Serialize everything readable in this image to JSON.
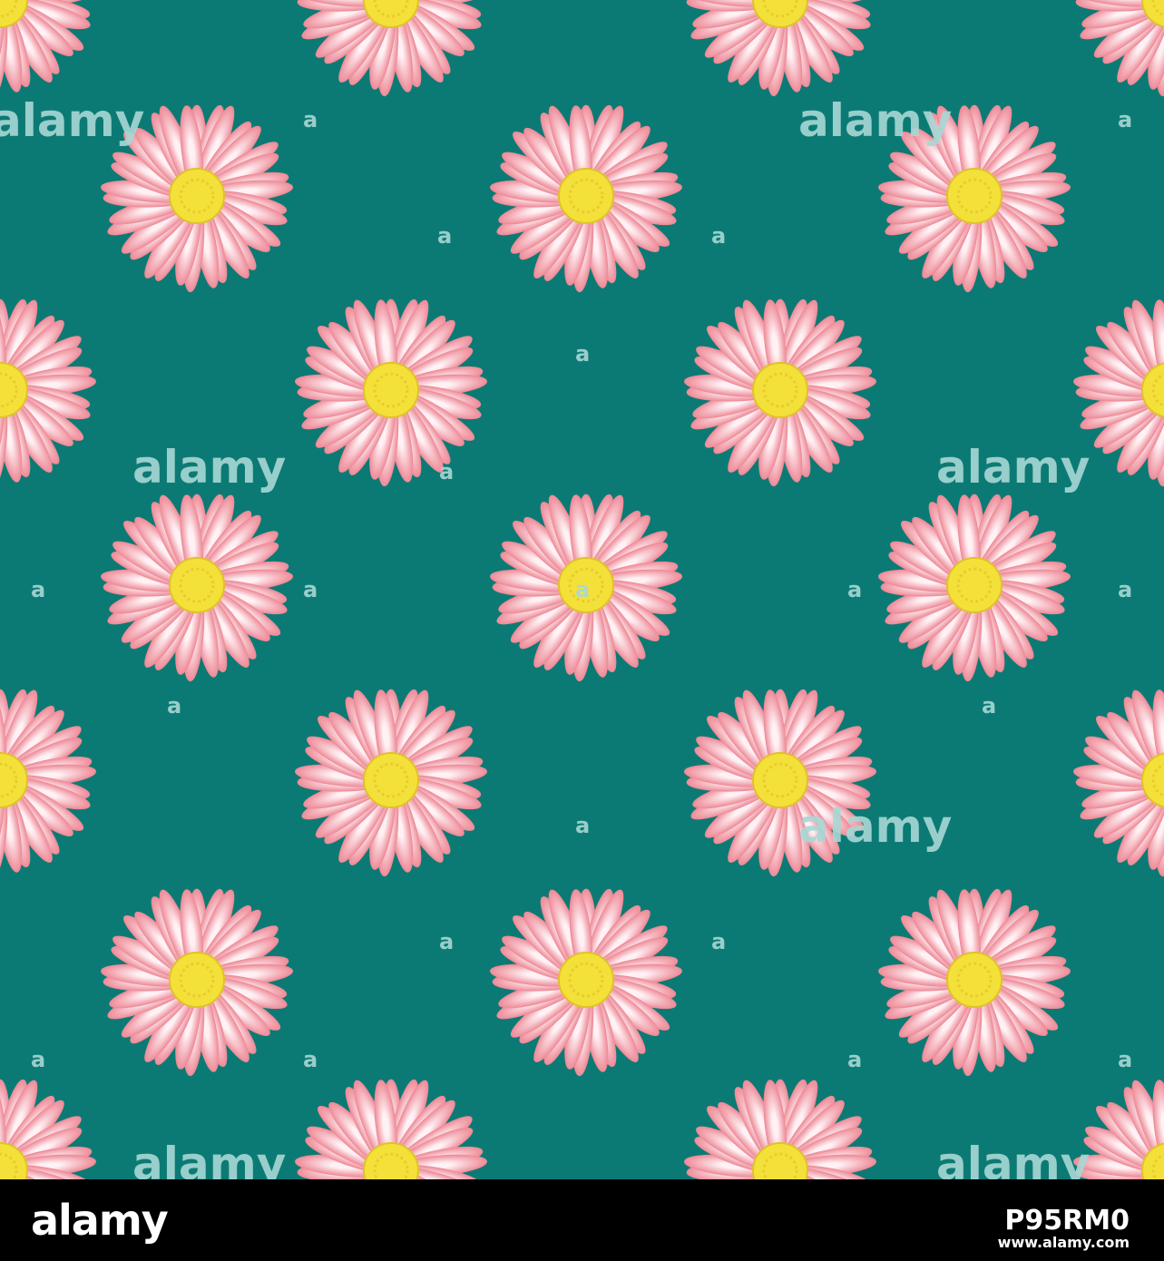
{
  "image": {
    "background_color": "#0c7a74",
    "petal_color_outer": "#ee8c99",
    "petal_color_inner": "#fff1f4",
    "center_color": "#f3e13a",
    "watermark_color": "#a8d8d5",
    "watermark_text": "alamy",
    "small_mark_text": "a"
  },
  "footer": {
    "logo": "alamy",
    "image_id": "P95RM0",
    "url": "www.alamy.com"
  }
}
